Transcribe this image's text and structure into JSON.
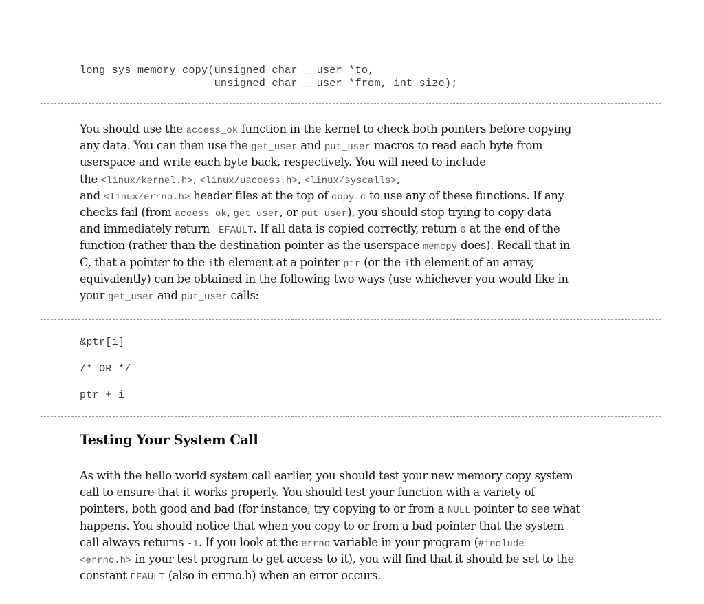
{
  "code_block_1": {
    "lines": [
      "long sys_memory_copy(unsigned char __user *to,",
      "                     unsigned char __user *from, int size);"
    ]
  },
  "paragraph_1": {
    "lines": [
      [
        {
          "t": "You should use the "
        },
        {
          "m": "access_ok"
        },
        {
          "t": " function in the kernel to check both pointers before copying"
        }
      ],
      [
        {
          "t": "any data. You can then use the "
        },
        {
          "m": "get_user"
        },
        {
          "t": " and "
        },
        {
          "m": "put_user"
        },
        {
          "t": " macros to read each byte from"
        }
      ],
      [
        {
          "t": "userspace and write each byte back, respectively. You will need to include"
        }
      ],
      [
        {
          "t": "the "
        },
        {
          "m": "<linux/kernel.h>"
        },
        {
          "t": ", "
        },
        {
          "m": "<linux/uaccess.h>"
        },
        {
          "t": ", "
        },
        {
          "m": "<linux/syscalls>"
        },
        {
          "t": ","
        }
      ],
      [
        {
          "t": "and "
        },
        {
          "m": "<linux/errno.h>"
        },
        {
          "t": " header files at the top of "
        },
        {
          "m": "copy.c"
        },
        {
          "t": " to use any of these functions. If any"
        }
      ],
      [
        {
          "t": "checks fail (from "
        },
        {
          "m": "access_ok"
        },
        {
          "t": ", "
        },
        {
          "m": "get_user"
        },
        {
          "t": ", or "
        },
        {
          "m": "put_user"
        },
        {
          "t": "), you should stop trying to copy data"
        }
      ],
      [
        {
          "t": "and immediately return "
        },
        {
          "m": "-EFAULT"
        },
        {
          "t": ". If all data is copied correctly, return "
        },
        {
          "m": "0"
        },
        {
          "t": " at the end of the"
        }
      ],
      [
        {
          "t": "function (rather than the destination pointer as the userspace "
        },
        {
          "m": "memcpy"
        },
        {
          "t": " does). Recall that in"
        }
      ],
      [
        {
          "t": "C, that a pointer to the "
        },
        {
          "m": "i"
        },
        {
          "t": "th element at a pointer "
        },
        {
          "m": "ptr"
        },
        {
          "t": " (or the "
        },
        {
          "m": "i"
        },
        {
          "t": "th element of an array,"
        }
      ],
      [
        {
          "t": "equivalently) can be obtained in the following two ways (use whichever you would like in"
        }
      ],
      [
        {
          "t": "your "
        },
        {
          "m": "get_user"
        },
        {
          "t": " and "
        },
        {
          "m": "put_user"
        },
        {
          "t": " calls:"
        }
      ]
    ]
  },
  "code_block_2": {
    "lines": [
      "&ptr[i]",
      "/* OR */",
      "ptr + i"
    ]
  },
  "section_heading": "Testing Your System Call",
  "paragraph_2": {
    "lines": [
      [
        {
          "t": "As with the hello world system call earlier, you should test your new memory copy system"
        }
      ],
      [
        {
          "t": "call to ensure that it works properly. You should test your function with a variety of"
        }
      ],
      [
        {
          "t": "pointers, both good and bad (for instance, try copying to or from a "
        },
        {
          "m": "NULL"
        },
        {
          "t": " pointer to see what"
        }
      ],
      [
        {
          "t": "happens. You should notice that when you copy to or from a bad pointer that the system"
        }
      ],
      [
        {
          "t": "call always returns "
        },
        {
          "m": "-1"
        },
        {
          "t": ". If you look at the "
        },
        {
          "m": "errno"
        },
        {
          "t": " variable in your program ("
        },
        {
          "m": "#include"
        }
      ],
      [
        {
          "m": "<errno.h>"
        },
        {
          "t": " in your test program to get access to it), you will find that it should be set to the"
        }
      ],
      [
        {
          "t": "constant "
        },
        {
          "m": "EFAULT"
        },
        {
          "t": " (also in errno.h) when an error occurs."
        }
      ]
    ]
  }
}
